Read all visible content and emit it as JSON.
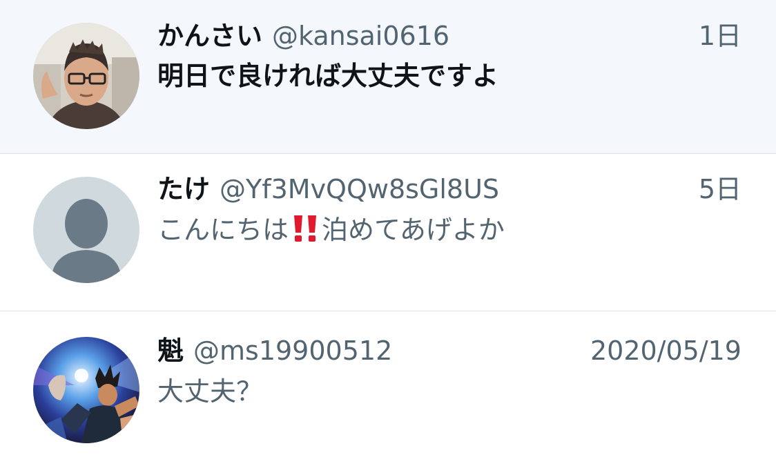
{
  "conversations": [
    {
      "name": "かんさい",
      "handle": "@kansai0616",
      "time": "1日",
      "message": "明日で良ければ大丈夫ですよ",
      "unread": true,
      "avatar_icon": "user-photo-avatar"
    },
    {
      "name": "たけ",
      "handle": "@Yf3MvQQw8sGl8US",
      "time": "5日",
      "message_before": "こんにちは",
      "message_emoji": "double-exclamation-icon",
      "message_after": "泊めてあげよか",
      "unread": false,
      "avatar_icon": "default-profile-avatar"
    },
    {
      "name": "魁",
      "handle": "@ms19900512",
      "time": "2020/05/19",
      "message": "大丈夫？",
      "unread": false,
      "avatar_icon": "anime-character-avatar"
    }
  ],
  "colors": {
    "unread_background": "#f4f7fc",
    "divider": "#dde1e5",
    "primary_text": "#0f1419",
    "secondary_text": "#536471",
    "exclamation_red": "#e0192f",
    "default_avatar_bg": "#cfd9de",
    "default_avatar_fg": "#6b7a87"
  }
}
